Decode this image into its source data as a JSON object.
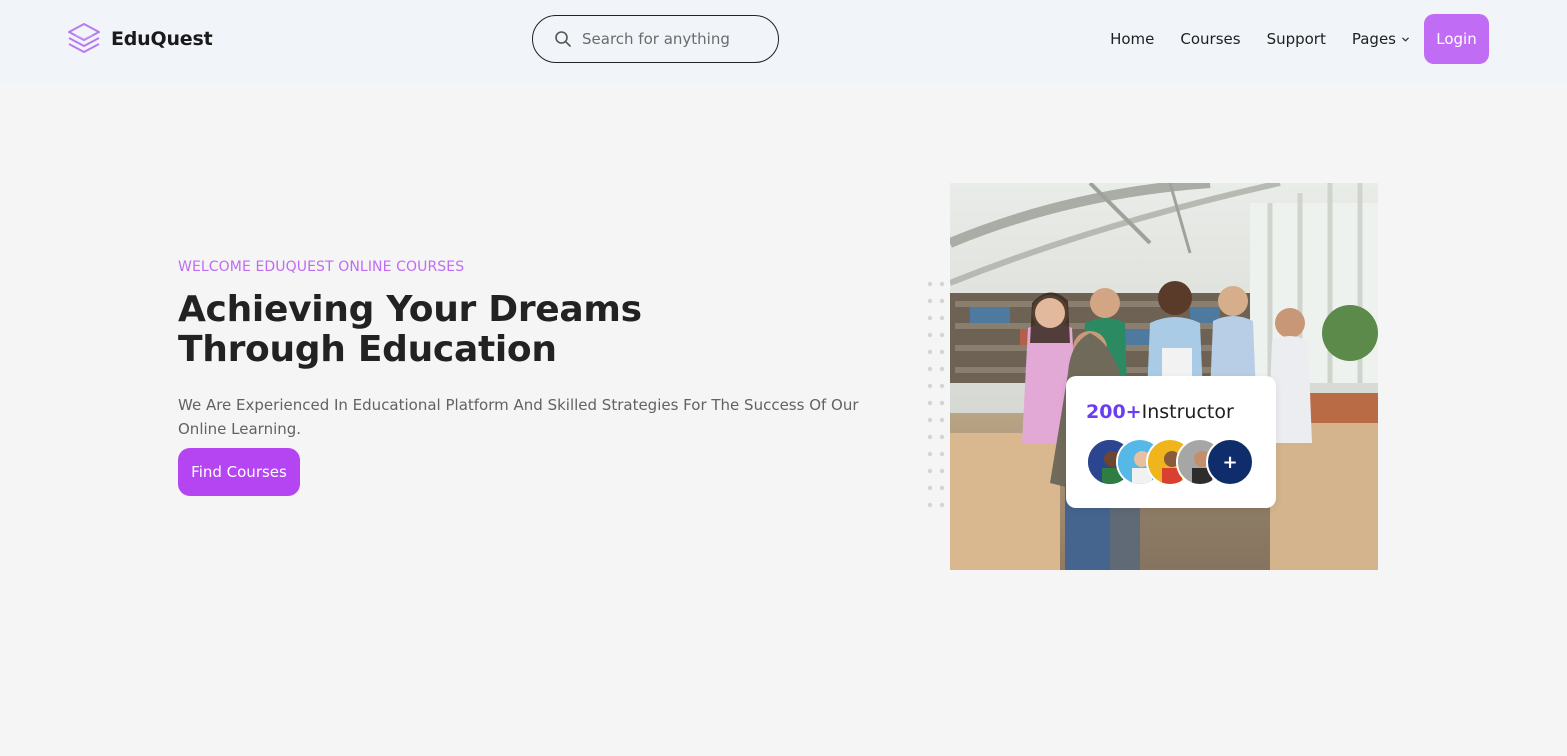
{
  "brand": {
    "name": "EduQuest",
    "icon": "layers-icon",
    "accent": "#b545f3"
  },
  "search": {
    "placeholder": "Search for anything",
    "value": ""
  },
  "nav": {
    "items": [
      {
        "label": "Home"
      },
      {
        "label": "Courses"
      },
      {
        "label": "Support"
      },
      {
        "label": "Pages",
        "icon": "chevron-down-icon"
      }
    ],
    "login_label": "Login",
    "login_color": "#c06cf4"
  },
  "hero": {
    "eyebrow": "WELCOME EDUQUEST ONLINE COURSES",
    "headline": "Achieving Your Dreams Through Education",
    "description": "We Are Experienced In Educational Platform And Skilled Strategies For The Success Of Our Online Learning.",
    "cta_label": "Find Courses"
  },
  "instructor_card": {
    "count": "200+",
    "label": "Instructor",
    "more_label": "+",
    "count_color": "#6a3ef0"
  }
}
